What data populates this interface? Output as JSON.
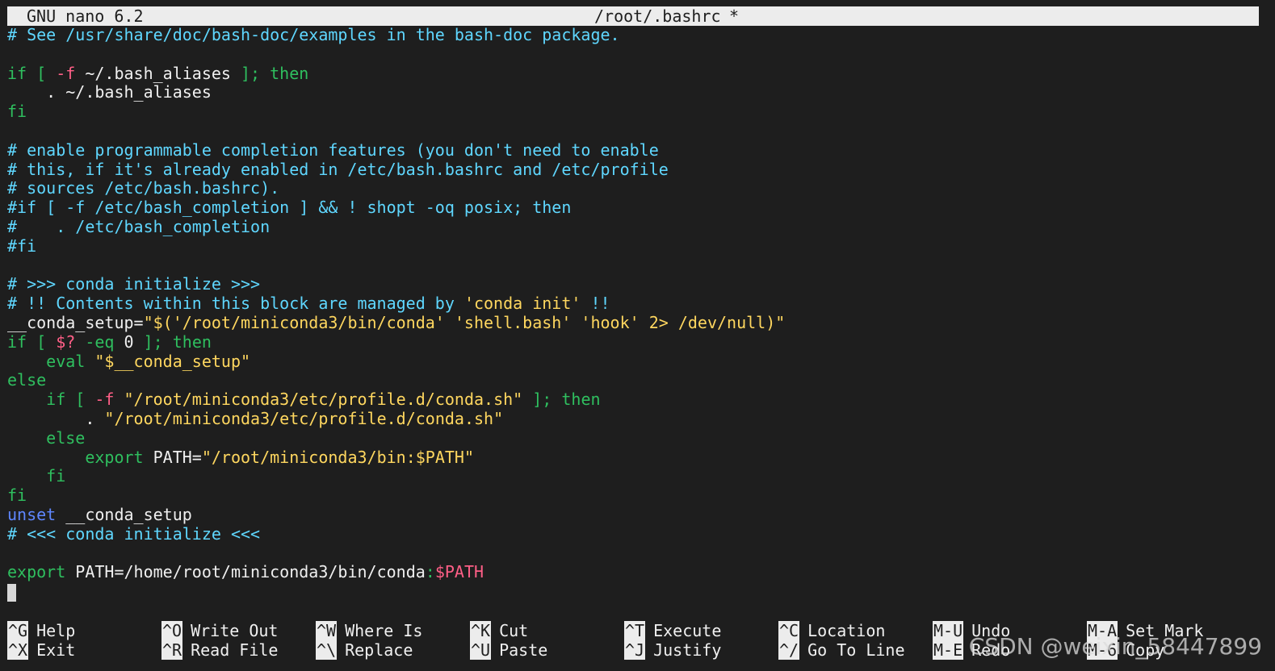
{
  "titlebar": {
    "app": "GNU nano 6.2",
    "filename": "/root/.bashrc",
    "modified_flag": "*"
  },
  "lines": [
    [
      {
        "c": "cmt",
        "t": "# See /usr/share/doc/bash-doc/examples in the bash-doc package."
      }
    ],
    [],
    [
      {
        "c": "kw",
        "t": "if [ "
      },
      {
        "c": "var",
        "t": "-f"
      },
      {
        "c": "plain",
        "t": " ~/.bash_aliases "
      },
      {
        "c": "kw",
        "t": "]; then"
      }
    ],
    [
      {
        "c": "plain",
        "t": "    . ~/.bash_aliases"
      }
    ],
    [
      {
        "c": "kw",
        "t": "fi"
      }
    ],
    [],
    [
      {
        "c": "cmt",
        "t": "# enable programmable completion features (you don't need to enable"
      }
    ],
    [
      {
        "c": "cmt",
        "t": "# this, if it's already enabled in /etc/bash.bashrc and /etc/profile"
      }
    ],
    [
      {
        "c": "cmt",
        "t": "# sources /etc/bash.bashrc)."
      }
    ],
    [
      {
        "c": "cmt",
        "t": "#if [ -f /etc/bash_completion ] && ! shopt -oq posix; then"
      }
    ],
    [
      {
        "c": "cmt",
        "t": "#    . /etc/bash_completion"
      }
    ],
    [
      {
        "c": "cmt",
        "t": "#fi"
      }
    ],
    [],
    [
      {
        "c": "cmt",
        "t": "# >>> conda initialize >>>"
      }
    ],
    [
      {
        "c": "cmt",
        "t": "# !! Contents within this block are managed by "
      },
      {
        "c": "str",
        "t": "'conda init'"
      },
      {
        "c": "cmt",
        "t": " !!"
      }
    ],
    [
      {
        "c": "plain",
        "t": "__conda_setup="
      },
      {
        "c": "str",
        "t": "\"$('/root/miniconda3/bin/conda' 'shell.bash' 'hook' 2> /dev/null)\""
      }
    ],
    [
      {
        "c": "kw",
        "t": "if [ "
      },
      {
        "c": "var",
        "t": "$?"
      },
      {
        "c": "kw",
        "t": " -eq "
      },
      {
        "c": "plain",
        "t": "0"
      },
      {
        "c": "kw",
        "t": " ]; then"
      }
    ],
    [
      {
        "c": "kw",
        "t": "    eval "
      },
      {
        "c": "str",
        "t": "\"$__conda_setup\""
      }
    ],
    [
      {
        "c": "kw",
        "t": "else"
      }
    ],
    [
      {
        "c": "kw",
        "t": "    if [ "
      },
      {
        "c": "var",
        "t": "-f"
      },
      {
        "c": "plain",
        "t": " "
      },
      {
        "c": "str",
        "t": "\"/root/miniconda3/etc/profile.d/conda.sh\""
      },
      {
        "c": "kw",
        "t": " ]; then"
      }
    ],
    [
      {
        "c": "plain",
        "t": "        . "
      },
      {
        "c": "str",
        "t": "\"/root/miniconda3/etc/profile.d/conda.sh\""
      }
    ],
    [
      {
        "c": "kw",
        "t": "    else"
      }
    ],
    [
      {
        "c": "kw",
        "t": "        export "
      },
      {
        "c": "plain",
        "t": "PATH="
      },
      {
        "c": "str",
        "t": "\"/root/miniconda3/bin:$PATH\""
      }
    ],
    [
      {
        "c": "kw",
        "t": "    fi"
      }
    ],
    [
      {
        "c": "kw",
        "t": "fi"
      }
    ],
    [
      {
        "c": "blue",
        "t": "unset"
      },
      {
        "c": "plain",
        "t": " __conda_setup"
      }
    ],
    [
      {
        "c": "cmt",
        "t": "# <<< conda initialize <<<"
      }
    ],
    [],
    [
      {
        "c": "kw",
        "t": "export "
      },
      {
        "c": "plain",
        "t": "PATH=/home/root/miniconda3/bin/conda"
      },
      {
        "c": "kw",
        "t": ":"
      },
      {
        "c": "var",
        "t": "$PATH"
      }
    ]
  ],
  "shortcuts": [
    [
      {
        "key": "^G",
        "label": "Help"
      },
      {
        "key": "^X",
        "label": "Exit"
      }
    ],
    [
      {
        "key": "^O",
        "label": "Write Out"
      },
      {
        "key": "^R",
        "label": "Read File"
      }
    ],
    [
      {
        "key": "^W",
        "label": "Where Is"
      },
      {
        "key": "^\\",
        "label": "Replace"
      }
    ],
    [
      {
        "key": "^K",
        "label": "Cut"
      },
      {
        "key": "^U",
        "label": "Paste"
      }
    ],
    [
      {
        "key": "^T",
        "label": "Execute"
      },
      {
        "key": "^J",
        "label": "Justify"
      }
    ],
    [
      {
        "key": "^C",
        "label": "Location"
      },
      {
        "key": "^/",
        "label": "Go To Line"
      }
    ],
    [
      {
        "key": "M-U",
        "label": "Undo"
      },
      {
        "key": "M-E",
        "label": "Redo"
      }
    ],
    [
      {
        "key": "M-A",
        "label": "Set Mark"
      },
      {
        "key": "M-6",
        "label": "Copy"
      }
    ]
  ],
  "watermark": "CSDN @weixin_58447899",
  "colors": {
    "background": "#1e1e1e",
    "comment": "#5fd7ff",
    "keyword": "#2fbf5f",
    "string": "#ffd75f",
    "variable": "#ff5f87",
    "titlebar": "#ececec"
  }
}
